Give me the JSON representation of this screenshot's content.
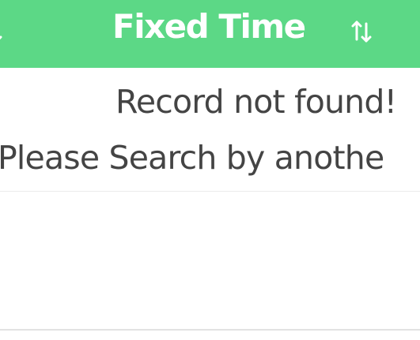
{
  "table": {
    "header": {
      "column_title": "Fixed Time",
      "sort_icon": "sort-up-down-icon",
      "left_sort_icon": "sort-icon-fragment",
      "background_color": "#5cd886",
      "text_color": "#ffffff"
    },
    "empty_state": {
      "line1": "Record not found!",
      "line2": "Please Search by anothe",
      "text_color": "#444444"
    }
  }
}
